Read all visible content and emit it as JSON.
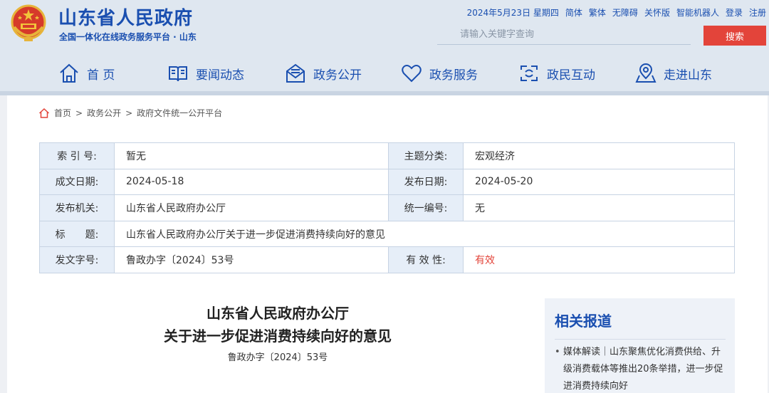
{
  "header": {
    "site_title": "山东省人民政府",
    "site_subtitle": "全国一体化在线政务服务平台 · 山东",
    "date": "2024年5月23日 星期四",
    "links": [
      "简体",
      "繁体",
      "无障碍",
      "关怀版",
      "智能机器人",
      "登录",
      "注册"
    ],
    "search_placeholder": "请输入关键字查询",
    "search_button": "搜索"
  },
  "nav": {
    "items": [
      {
        "label": "首 页",
        "icon": "home-icon"
      },
      {
        "label": "要闻动态",
        "icon": "book-icon"
      },
      {
        "label": "政务公开",
        "icon": "mail-open-icon"
      },
      {
        "label": "政务服务",
        "icon": "heart-icon"
      },
      {
        "label": "政民互动",
        "icon": "interaction-icon"
      },
      {
        "label": "走进山东",
        "icon": "location-icon"
      }
    ]
  },
  "breadcrumb": [
    "首页",
    "政务公开",
    "政府文件统一公开平台"
  ],
  "meta": {
    "index_no_label": "索 引 号:",
    "index_no": "暂无",
    "topic_label": "主题分类:",
    "topic": "宏观经济",
    "created_label": "成文日期:",
    "created": "2024-05-18",
    "published_label": "发布日期:",
    "published": "2024-05-20",
    "issuer_label": "发布机关:",
    "issuer": "山东省人民政府办公厅",
    "uniform_no_label": "统一编号:",
    "uniform_no": "无",
    "title_label": "标　　题:",
    "title": "山东省人民政府办公厅关于进一步促进消费持续向好的意见",
    "doc_no_label": "发文字号:",
    "doc_no": "鲁政办字〔2024〕53号",
    "validity_label": "有 效 性:",
    "validity": "有效"
  },
  "document": {
    "title_line1": "山东省人民政府办公厅",
    "title_line2": "关于进一步促进消费持续向好的意见",
    "doc_no": "鲁政办字〔2024〕53号"
  },
  "related": {
    "title": "相关报道",
    "items": [
      "媒体解读｜山东聚焦优化消费供给、升级消费载体等推出20条举措，进一步促进消费持续向好"
    ]
  },
  "colors": {
    "brand_blue": "#1a4fb0",
    "search_red": "#e3443a",
    "label_bg": "#e6eef8"
  }
}
